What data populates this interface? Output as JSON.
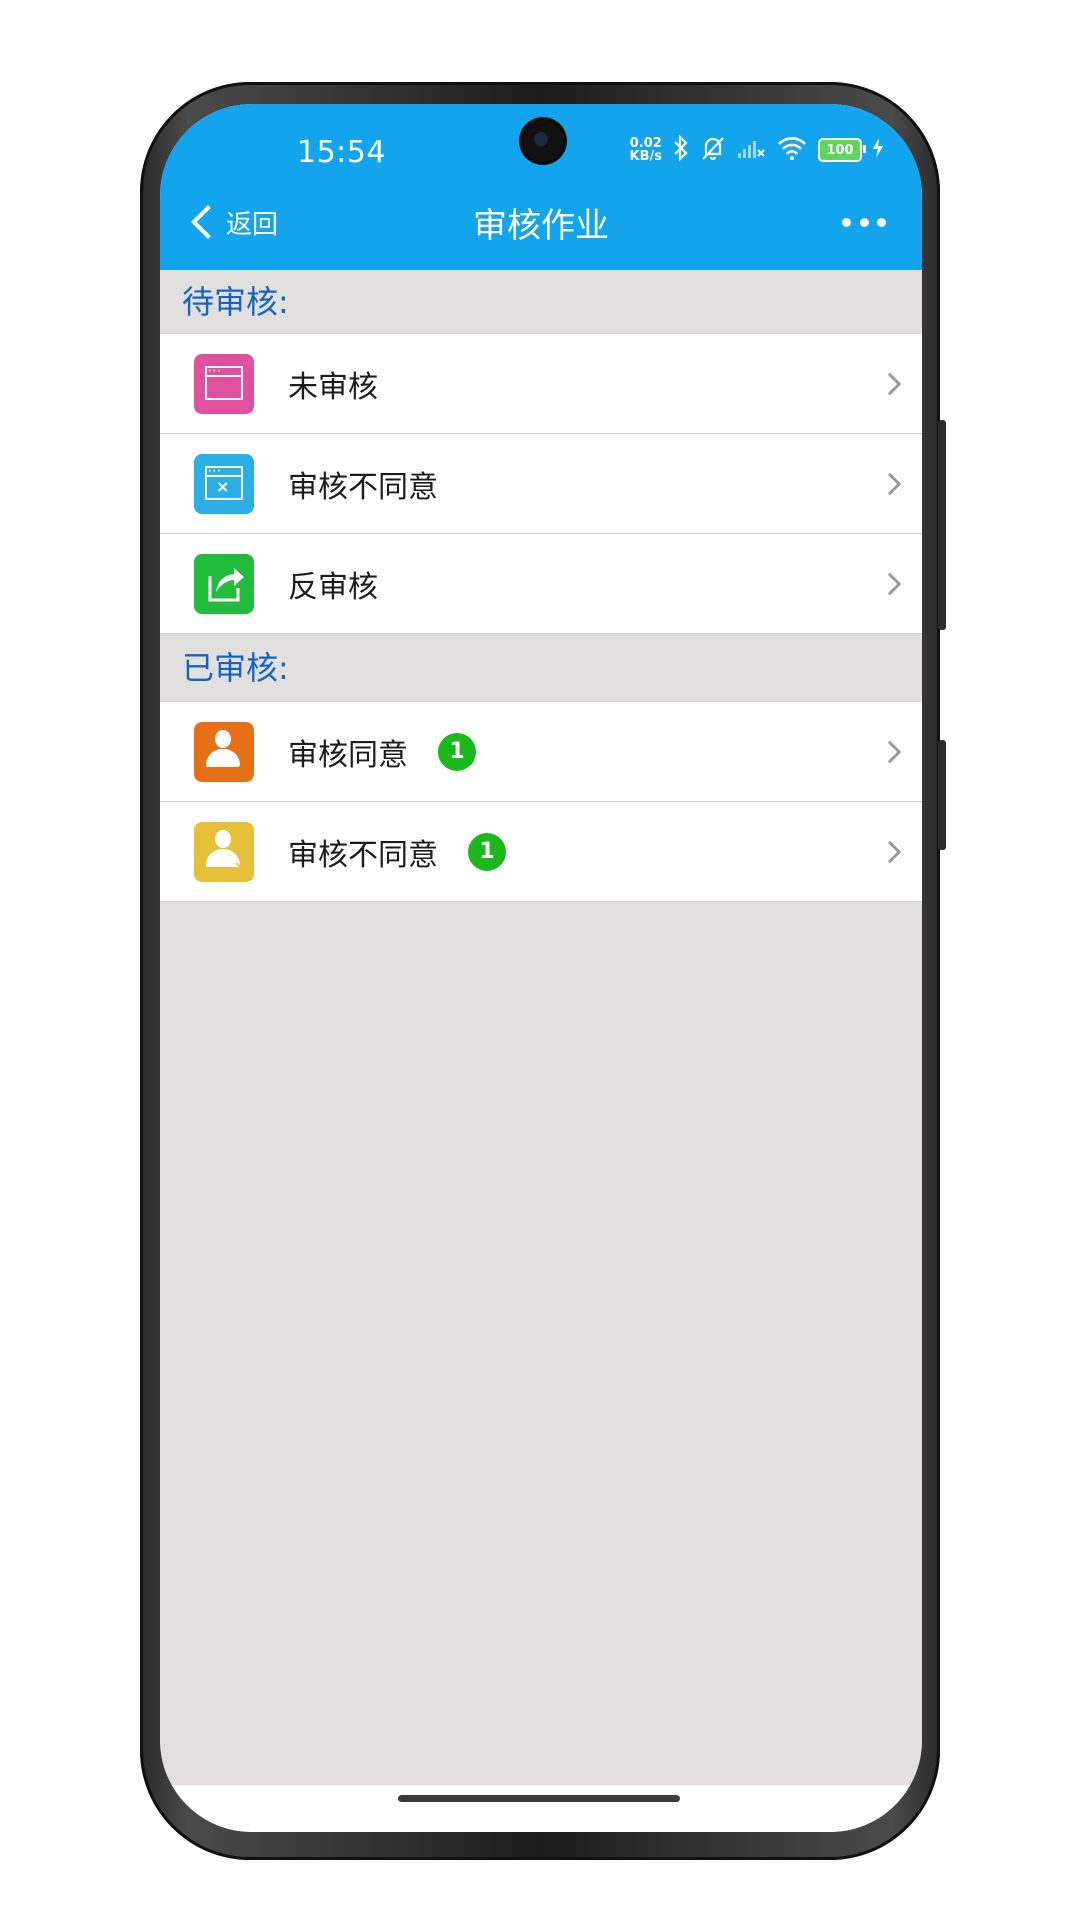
{
  "status_bar": {
    "time": "15:54",
    "net_speed_value": "0.02",
    "net_speed_unit": "KB/s",
    "battery": "100",
    "icons": [
      "bluetooth-icon",
      "bell-off-icon",
      "signal-icon",
      "wifi-icon",
      "battery-icon",
      "charging-icon"
    ]
  },
  "nav_bar": {
    "back_label": "返回",
    "title": "审核作业",
    "more_icon": "more-icon"
  },
  "sections": [
    {
      "header": "待审核:",
      "items": [
        {
          "label": "未审核",
          "icon": "window-icon",
          "icon_color": "#e0509e"
        },
        {
          "label": "审核不同意",
          "icon": "window-close-icon",
          "icon_color": "#2ab0e4"
        },
        {
          "label": "反审核",
          "icon": "share-icon",
          "icon_color": "#22bb3b"
        }
      ]
    },
    {
      "header": "已审核:",
      "items": [
        {
          "label": "审核同意",
          "icon": "user-check-icon",
          "icon_color": "#e67016",
          "badge": "1"
        },
        {
          "label": "审核不同意",
          "icon": "user-cross-icon",
          "icon_color": "#e6c038",
          "badge": "1"
        }
      ]
    }
  ],
  "colors": {
    "nav_bg": "#12a4ec",
    "section_text": "#1565c0",
    "badge_bg": "#1bb81b",
    "content_bg": "#e1e0df"
  }
}
